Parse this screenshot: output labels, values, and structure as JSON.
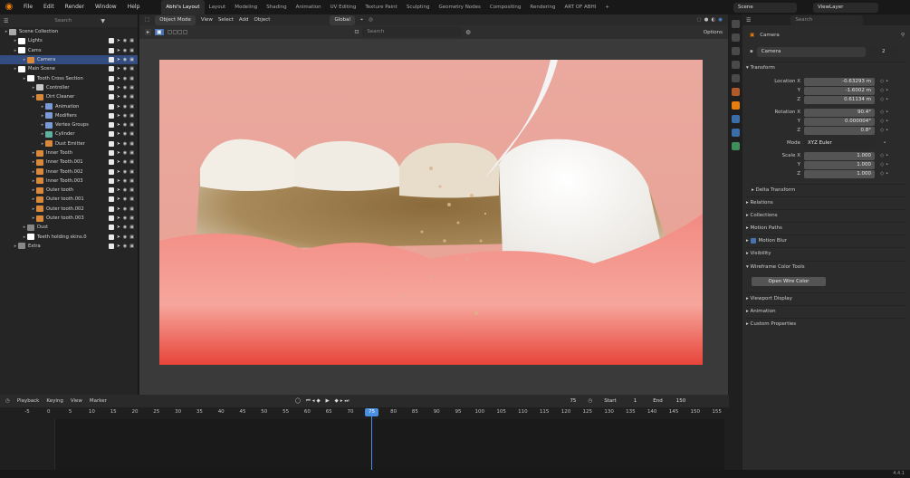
{
  "menu": [
    "File",
    "Edit",
    "Render",
    "Window",
    "Help"
  ],
  "workspaces": [
    "Abhi's Layout",
    "Layout",
    "Modeling",
    "Shading",
    "Animation",
    "UV Editing",
    "Texture Paint",
    "Sculpting",
    "Geometry Nodes",
    "Compositing",
    "Rendering",
    "ART OF ABHI"
  ],
  "active_workspace": "Abhi's Layout",
  "top_right": {
    "scene": "Scene",
    "view_layer": "ViewLayer"
  },
  "outliner": {
    "search_placeholder": "Search",
    "rows": [
      {
        "label": "Scene Collection",
        "indent": 0,
        "color": "#aaaaaa"
      },
      {
        "label": "Lights",
        "indent": 1,
        "color": "#ffffff"
      },
      {
        "label": "Cams",
        "indent": 1,
        "color": "#ffffff"
      },
      {
        "label": "Camera",
        "indent": 2,
        "color": "#d9893c",
        "selected": true
      },
      {
        "label": "Main Scene",
        "indent": 1,
        "color": "#ffffff"
      },
      {
        "label": "Tooth Cross Section",
        "indent": 2,
        "color": "#ffffff"
      },
      {
        "label": "Controller",
        "indent": 3,
        "color": "#c8c8c8"
      },
      {
        "label": "Dirt Cleaner",
        "indent": 3,
        "color": "#d9893c"
      },
      {
        "label": "Animation",
        "indent": 4,
        "color": "#7a9ad8"
      },
      {
        "label": "Modifiers",
        "indent": 4,
        "color": "#7a9ad8"
      },
      {
        "label": "Vertex Groups",
        "indent": 4,
        "color": "#7a9ad8"
      },
      {
        "label": "Cylinder",
        "indent": 4,
        "color": "#5fb0a0"
      },
      {
        "label": "Dust Emitter",
        "indent": 4,
        "color": "#d9893c"
      },
      {
        "label": "Inner Tooth",
        "indent": 3,
        "color": "#d9893c"
      },
      {
        "label": "Inner Tooth.001",
        "indent": 3,
        "color": "#d9893c"
      },
      {
        "label": "Inner Tooth.002",
        "indent": 3,
        "color": "#d9893c"
      },
      {
        "label": "Inner Tooth.003",
        "indent": 3,
        "color": "#d9893c"
      },
      {
        "label": "Outer tooth",
        "indent": 3,
        "color": "#d9893c"
      },
      {
        "label": "Outer tooth.001",
        "indent": 3,
        "color": "#d9893c"
      },
      {
        "label": "Outer tooth.002",
        "indent": 3,
        "color": "#d9893c"
      },
      {
        "label": "Outer tooth.003",
        "indent": 3,
        "color": "#d9893c"
      },
      {
        "label": "Dust",
        "indent": 2,
        "color": "#888888"
      },
      {
        "label": "Teeth holding skins.0",
        "indent": 2,
        "color": "#ffffff"
      },
      {
        "label": "Extra",
        "indent": 1,
        "color": "#888888"
      }
    ]
  },
  "viewport": {
    "header1": [
      "Object Mode",
      "View",
      "Select",
      "Add",
      "Object"
    ],
    "transform_orientation": "Global",
    "options": "Options",
    "search_placeholder": "Search"
  },
  "properties": {
    "search_placeholder": "Search",
    "object_name": "Camera",
    "data_name": "Camera",
    "users": "2",
    "transform": "Transform",
    "location": {
      "label": "Location X",
      "x": "-0.63293 m",
      "y": "-1.6002 m",
      "z": "0.61134 m"
    },
    "rotation": {
      "label": "Rotation X",
      "x": "90.4°",
      "y": "0.000004°",
      "z": "0.8°"
    },
    "mode_label": "Mode",
    "mode": "XYZ Euler",
    "scale": {
      "label": "Scale X",
      "x": "1.000",
      "y": "1.000",
      "z": "1.000"
    },
    "y_label": "Y",
    "z_label": "Z",
    "delta": "Delta Transform",
    "panels": [
      "Relations",
      "Collections",
      "Motion Paths",
      "Motion Blur",
      "Visibility",
      "Wireframe Color Tools"
    ],
    "wire_button": "Open Wire Color",
    "panels2": [
      "Viewport Display",
      "Animation",
      "Custom Properties"
    ]
  },
  "timeline": {
    "menus": [
      "Playback",
      "Keying",
      "View",
      "Marker"
    ],
    "current_frame": "75",
    "start_label": "Start",
    "start": "1",
    "end_label": "End",
    "end": "150",
    "ticks": [
      "-5",
      "0",
      "5",
      "10",
      "15",
      "20",
      "25",
      "30",
      "35",
      "40",
      "45",
      "50",
      "55",
      "60",
      "65",
      "70",
      "75",
      "80",
      "85",
      "90",
      "95",
      "100",
      "105",
      "110",
      "115",
      "120",
      "125",
      "130",
      "135",
      "140",
      "145",
      "150",
      "155"
    ]
  },
  "version": "4.4.1"
}
